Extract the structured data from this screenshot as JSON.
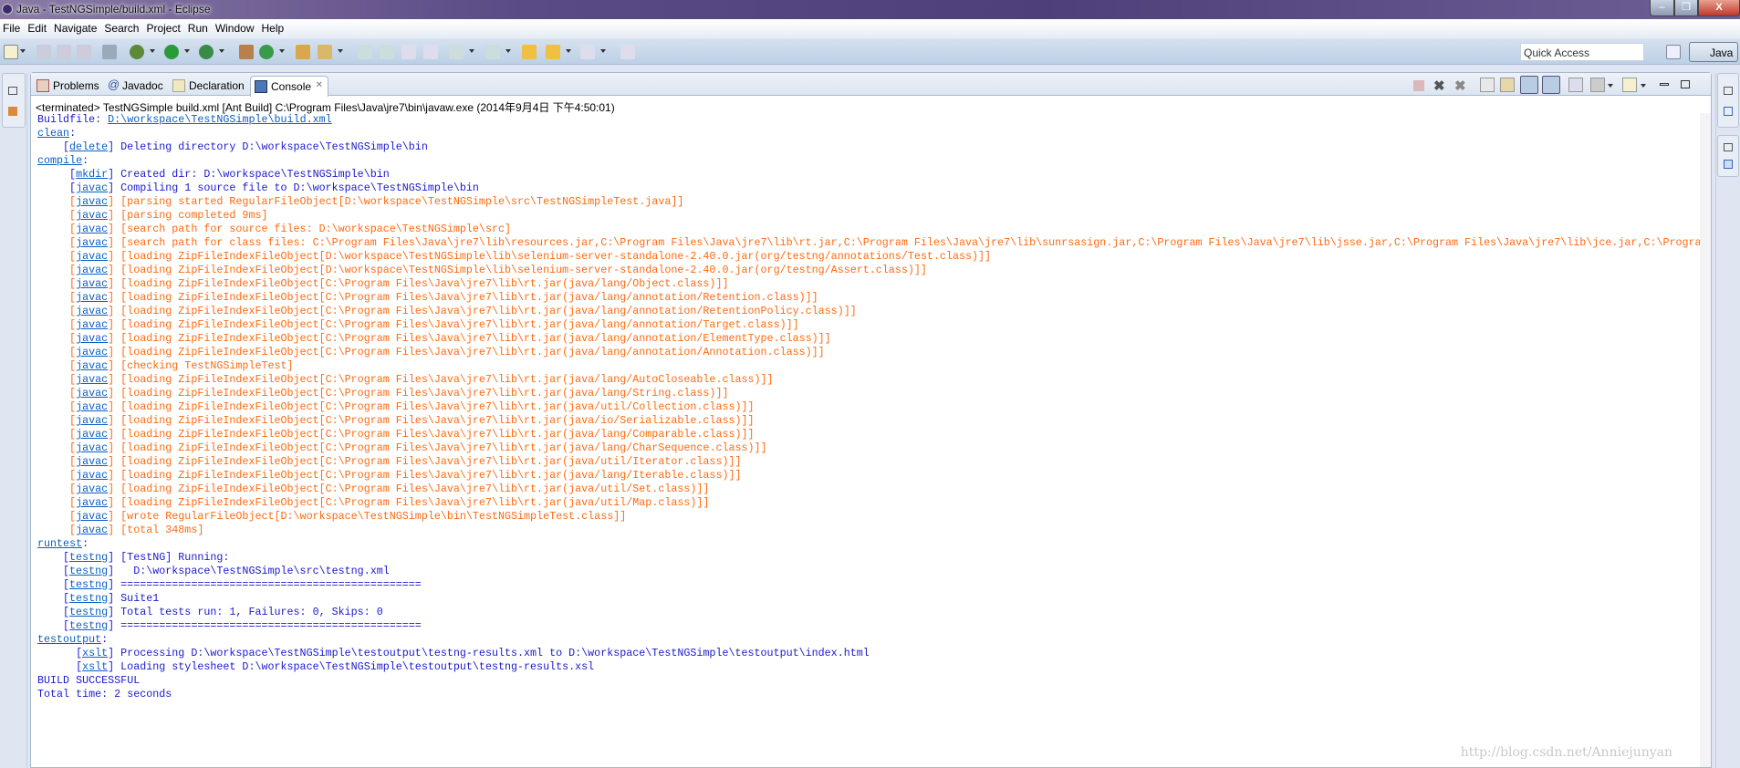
{
  "window": {
    "title": "Java - TestNGSimple/build.xml - Eclipse",
    "minimize": "–",
    "restore": "❐",
    "close": "X"
  },
  "menu": [
    "File",
    "Edit",
    "Navigate",
    "Search",
    "Project",
    "Run",
    "Window",
    "Help"
  ],
  "toolbar": {
    "quick_access_placeholder": "Quick Access",
    "perspective": "Java"
  },
  "tabs": [
    {
      "label": "Problems",
      "icon": "problems-icon"
    },
    {
      "label": "Javadoc",
      "icon": "at-icon",
      "glyph": "@"
    },
    {
      "label": "Declaration",
      "icon": "declaration-icon"
    },
    {
      "label": "Console",
      "icon": "console-icon",
      "active": true,
      "close": "✕"
    }
  ],
  "console": {
    "header": "<terminated> TestNGSimple build.xml [Ant Build] C:\\Program Files\\Java\\jre7\\bin\\javaw.exe (2014年9月4日 下午4:50:01)",
    "buildfile_label": "Buildfile: ",
    "buildfile_path": "D:\\workspace\\TestNGSimple\\build.xml",
    "lines": [
      {
        "target": "clean"
      },
      {
        "tag": "delete",
        "text": "Deleting directory D:\\workspace\\TestNGSimple\\bin",
        "color": "blue"
      },
      {
        "target": "compile"
      },
      {
        "tag": "mkdir",
        "text": "Created dir: D:\\workspace\\TestNGSimple\\bin",
        "color": "blue"
      },
      {
        "tag": "javac",
        "text": "Compiling 1 source file to D:\\workspace\\TestNGSimple\\bin",
        "color": "blue"
      },
      {
        "tag": "javac",
        "text": "[parsing started RegularFileObject[D:\\workspace\\TestNGSimple\\src\\TestNGSimpleTest.java]]",
        "color": "orange"
      },
      {
        "tag": "javac",
        "text": "[parsing completed 9ms]",
        "color": "orange"
      },
      {
        "tag": "javac",
        "text": "[search path for source files: D:\\workspace\\TestNGSimple\\src]",
        "color": "orange"
      },
      {
        "tag": "javac",
        "text": "[search path for class files: C:\\Program Files\\Java\\jre7\\lib\\resources.jar,C:\\Program Files\\Java\\jre7\\lib\\rt.jar,C:\\Program Files\\Java\\jre7\\lib\\sunrsasign.jar,C:\\Program Files\\Java\\jre7\\lib\\jsse.jar,C:\\Program Files\\Java\\jre7\\lib\\jce.jar,C:\\Progra",
        "color": "orange"
      },
      {
        "tag": "javac",
        "text": "[loading ZipFileIndexFileObject[D:\\workspace\\TestNGSimple\\lib\\selenium-server-standalone-2.40.0.jar(org/testng/annotations/Test.class)]]",
        "color": "orange"
      },
      {
        "tag": "javac",
        "text": "[loading ZipFileIndexFileObject[D:\\workspace\\TestNGSimple\\lib\\selenium-server-standalone-2.40.0.jar(org/testng/Assert.class)]]",
        "color": "orange"
      },
      {
        "tag": "javac",
        "text": "[loading ZipFileIndexFileObject[C:\\Program Files\\Java\\jre7\\lib\\rt.jar(java/lang/Object.class)]]",
        "color": "orange"
      },
      {
        "tag": "javac",
        "text": "[loading ZipFileIndexFileObject[C:\\Program Files\\Java\\jre7\\lib\\rt.jar(java/lang/annotation/Retention.class)]]",
        "color": "orange"
      },
      {
        "tag": "javac",
        "text": "[loading ZipFileIndexFileObject[C:\\Program Files\\Java\\jre7\\lib\\rt.jar(java/lang/annotation/RetentionPolicy.class)]]",
        "color": "orange"
      },
      {
        "tag": "javac",
        "text": "[loading ZipFileIndexFileObject[C:\\Program Files\\Java\\jre7\\lib\\rt.jar(java/lang/annotation/Target.class)]]",
        "color": "orange"
      },
      {
        "tag": "javac",
        "text": "[loading ZipFileIndexFileObject[C:\\Program Files\\Java\\jre7\\lib\\rt.jar(java/lang/annotation/ElementType.class)]]",
        "color": "orange"
      },
      {
        "tag": "javac",
        "text": "[loading ZipFileIndexFileObject[C:\\Program Files\\Java\\jre7\\lib\\rt.jar(java/lang/annotation/Annotation.class)]]",
        "color": "orange"
      },
      {
        "tag": "javac",
        "text": "[checking TestNGSimpleTest]",
        "color": "orange"
      },
      {
        "tag": "javac",
        "text": "[loading ZipFileIndexFileObject[C:\\Program Files\\Java\\jre7\\lib\\rt.jar(java/lang/AutoCloseable.class)]]",
        "color": "orange"
      },
      {
        "tag": "javac",
        "text": "[loading ZipFileIndexFileObject[C:\\Program Files\\Java\\jre7\\lib\\rt.jar(java/lang/String.class)]]",
        "color": "orange"
      },
      {
        "tag": "javac",
        "text": "[loading ZipFileIndexFileObject[C:\\Program Files\\Java\\jre7\\lib\\rt.jar(java/util/Collection.class)]]",
        "color": "orange"
      },
      {
        "tag": "javac",
        "text": "[loading ZipFileIndexFileObject[C:\\Program Files\\Java\\jre7\\lib\\rt.jar(java/io/Serializable.class)]]",
        "color": "orange"
      },
      {
        "tag": "javac",
        "text": "[loading ZipFileIndexFileObject[C:\\Program Files\\Java\\jre7\\lib\\rt.jar(java/lang/Comparable.class)]]",
        "color": "orange"
      },
      {
        "tag": "javac",
        "text": "[loading ZipFileIndexFileObject[C:\\Program Files\\Java\\jre7\\lib\\rt.jar(java/lang/CharSequence.class)]]",
        "color": "orange"
      },
      {
        "tag": "javac",
        "text": "[loading ZipFileIndexFileObject[C:\\Program Files\\Java\\jre7\\lib\\rt.jar(java/util/Iterator.class)]]",
        "color": "orange"
      },
      {
        "tag": "javac",
        "text": "[loading ZipFileIndexFileObject[C:\\Program Files\\Java\\jre7\\lib\\rt.jar(java/lang/Iterable.class)]]",
        "color": "orange"
      },
      {
        "tag": "javac",
        "text": "[loading ZipFileIndexFileObject[C:\\Program Files\\Java\\jre7\\lib\\rt.jar(java/util/Set.class)]]",
        "color": "orange"
      },
      {
        "tag": "javac",
        "text": "[loading ZipFileIndexFileObject[C:\\Program Files\\Java\\jre7\\lib\\rt.jar(java/util/Map.class)]]",
        "color": "orange"
      },
      {
        "tag": "javac",
        "text": "[wrote RegularFileObject[D:\\workspace\\TestNGSimple\\bin\\TestNGSimpleTest.class]]",
        "color": "orange"
      },
      {
        "tag": "javac",
        "text": "[total 348ms]",
        "color": "orange"
      },
      {
        "target": "runtest"
      },
      {
        "tag": "testng",
        "text": "[TestNG] Running:",
        "color": "blue"
      },
      {
        "tag": "testng",
        "text": "  D:\\workspace\\TestNGSimple\\src\\testng.xml",
        "color": "blue"
      },
      {
        "tag": "testng",
        "text": "===============================================",
        "color": "blue"
      },
      {
        "tag": "testng",
        "text": "Suite1",
        "color": "blue"
      },
      {
        "tag": "testng",
        "text": "Total tests run: 1, Failures: 0, Skips: 0",
        "color": "blue"
      },
      {
        "tag": "testng",
        "text": "===============================================",
        "color": "blue"
      },
      {
        "target": "testoutput"
      },
      {
        "tag": "xslt",
        "text": "Processing D:\\workspace\\TestNGSimple\\testoutput\\testng-results.xml to D:\\workspace\\TestNGSimple\\testoutput\\index.html",
        "color": "blue"
      },
      {
        "tag": "xslt",
        "text": "Loading stylesheet D:\\workspace\\TestNGSimple\\testoutput\\testng-results.xsl",
        "color": "blue"
      },
      {
        "text": "BUILD SUCCESSFUL",
        "color": "blue"
      },
      {
        "text": "Total time: 2 seconds",
        "color": "blue"
      }
    ]
  },
  "watermark": "http://blog.csdn.net/Anniejunyan",
  "colors": {
    "blue": "#1a1ad0",
    "orange": "#ff6a10",
    "link": "#0a5fc4"
  }
}
